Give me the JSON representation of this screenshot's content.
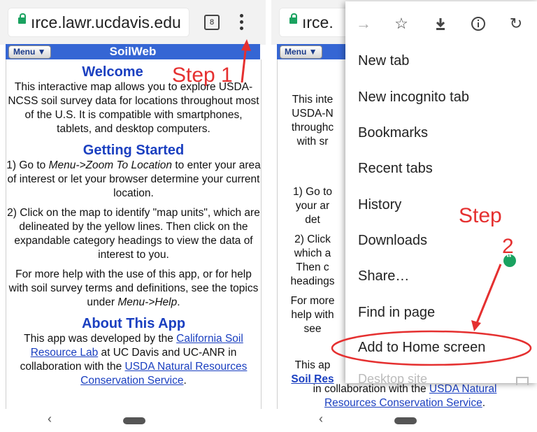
{
  "left": {
    "url": "ırce.lawr.ucdavis.edu",
    "tab_count": "8",
    "menu_label": "Menu ▼",
    "app_title": "SoilWeb",
    "welcome": "Welcome",
    "intro": "This interactive map allows you to explore USDA-NCSS soil survey data for locations throughout most of the U.S. It is compatible with smartphones, tablets, and desktop computers.",
    "getting_started": "Getting Started",
    "step1_pre": "1) Go to ",
    "step1_em": "Menu->Zoom To Location",
    "step1_post": " to enter your area of interest or let your browser determine your current location.",
    "step2_text": "2) Click on the map to identify \"map units\", which are delineated by the yellow lines. Then click on the expandable category headings to view the data of interest to you.",
    "help_pre": "For more help with the use of this app, or for help with soil survey terms and definitions, see the topics under ",
    "help_em": "Menu->Help",
    "help_post": ".",
    "about_title": "About This App",
    "about_pre": "This app was developed by the ",
    "about_link1": "California Soil Resource Lab",
    "about_mid": " at UC Davis and UC-ANR in collaboration with the ",
    "about_link2": "USDA Natural Resources Conservation Service",
    "about_post": ".",
    "annotation": "Step 1"
  },
  "right": {
    "url": "ırce.",
    "menu_label": "Menu ▼",
    "bg_lines": [
      "This inte",
      "USDA-N",
      "throughc",
      "with sr",
      "1) Go to",
      "your ar",
      "det",
      "2) Click",
      "which a",
      "Then c",
      "headings",
      "For more",
      "help with",
      "see",
      "This ap",
      "Soil Res"
    ],
    "bottom_line1_pre": "in collaboration with the ",
    "bottom_link1": "USDA Natural",
    "bottom_link2": "Resources Conservation Service",
    "bottom_post": ".",
    "menu_items": [
      "New tab",
      "New incognito tab",
      "Bookmarks",
      "Recent tabs",
      "History",
      "Downloads",
      "Share…",
      "Find in page",
      "Add to Home screen"
    ],
    "peek_item": "Desktop site",
    "annotation_word": "Step",
    "annotation_num": "2"
  },
  "colors": {
    "accent_blue": "#3566d4",
    "link_blue": "#1a3fc0",
    "annotation_red": "#e53030",
    "secure_green": "#1aa260"
  },
  "icons": {
    "toolbar": [
      "forward-arrow-icon",
      "star-icon",
      "download-icon",
      "info-icon",
      "refresh-icon"
    ]
  }
}
